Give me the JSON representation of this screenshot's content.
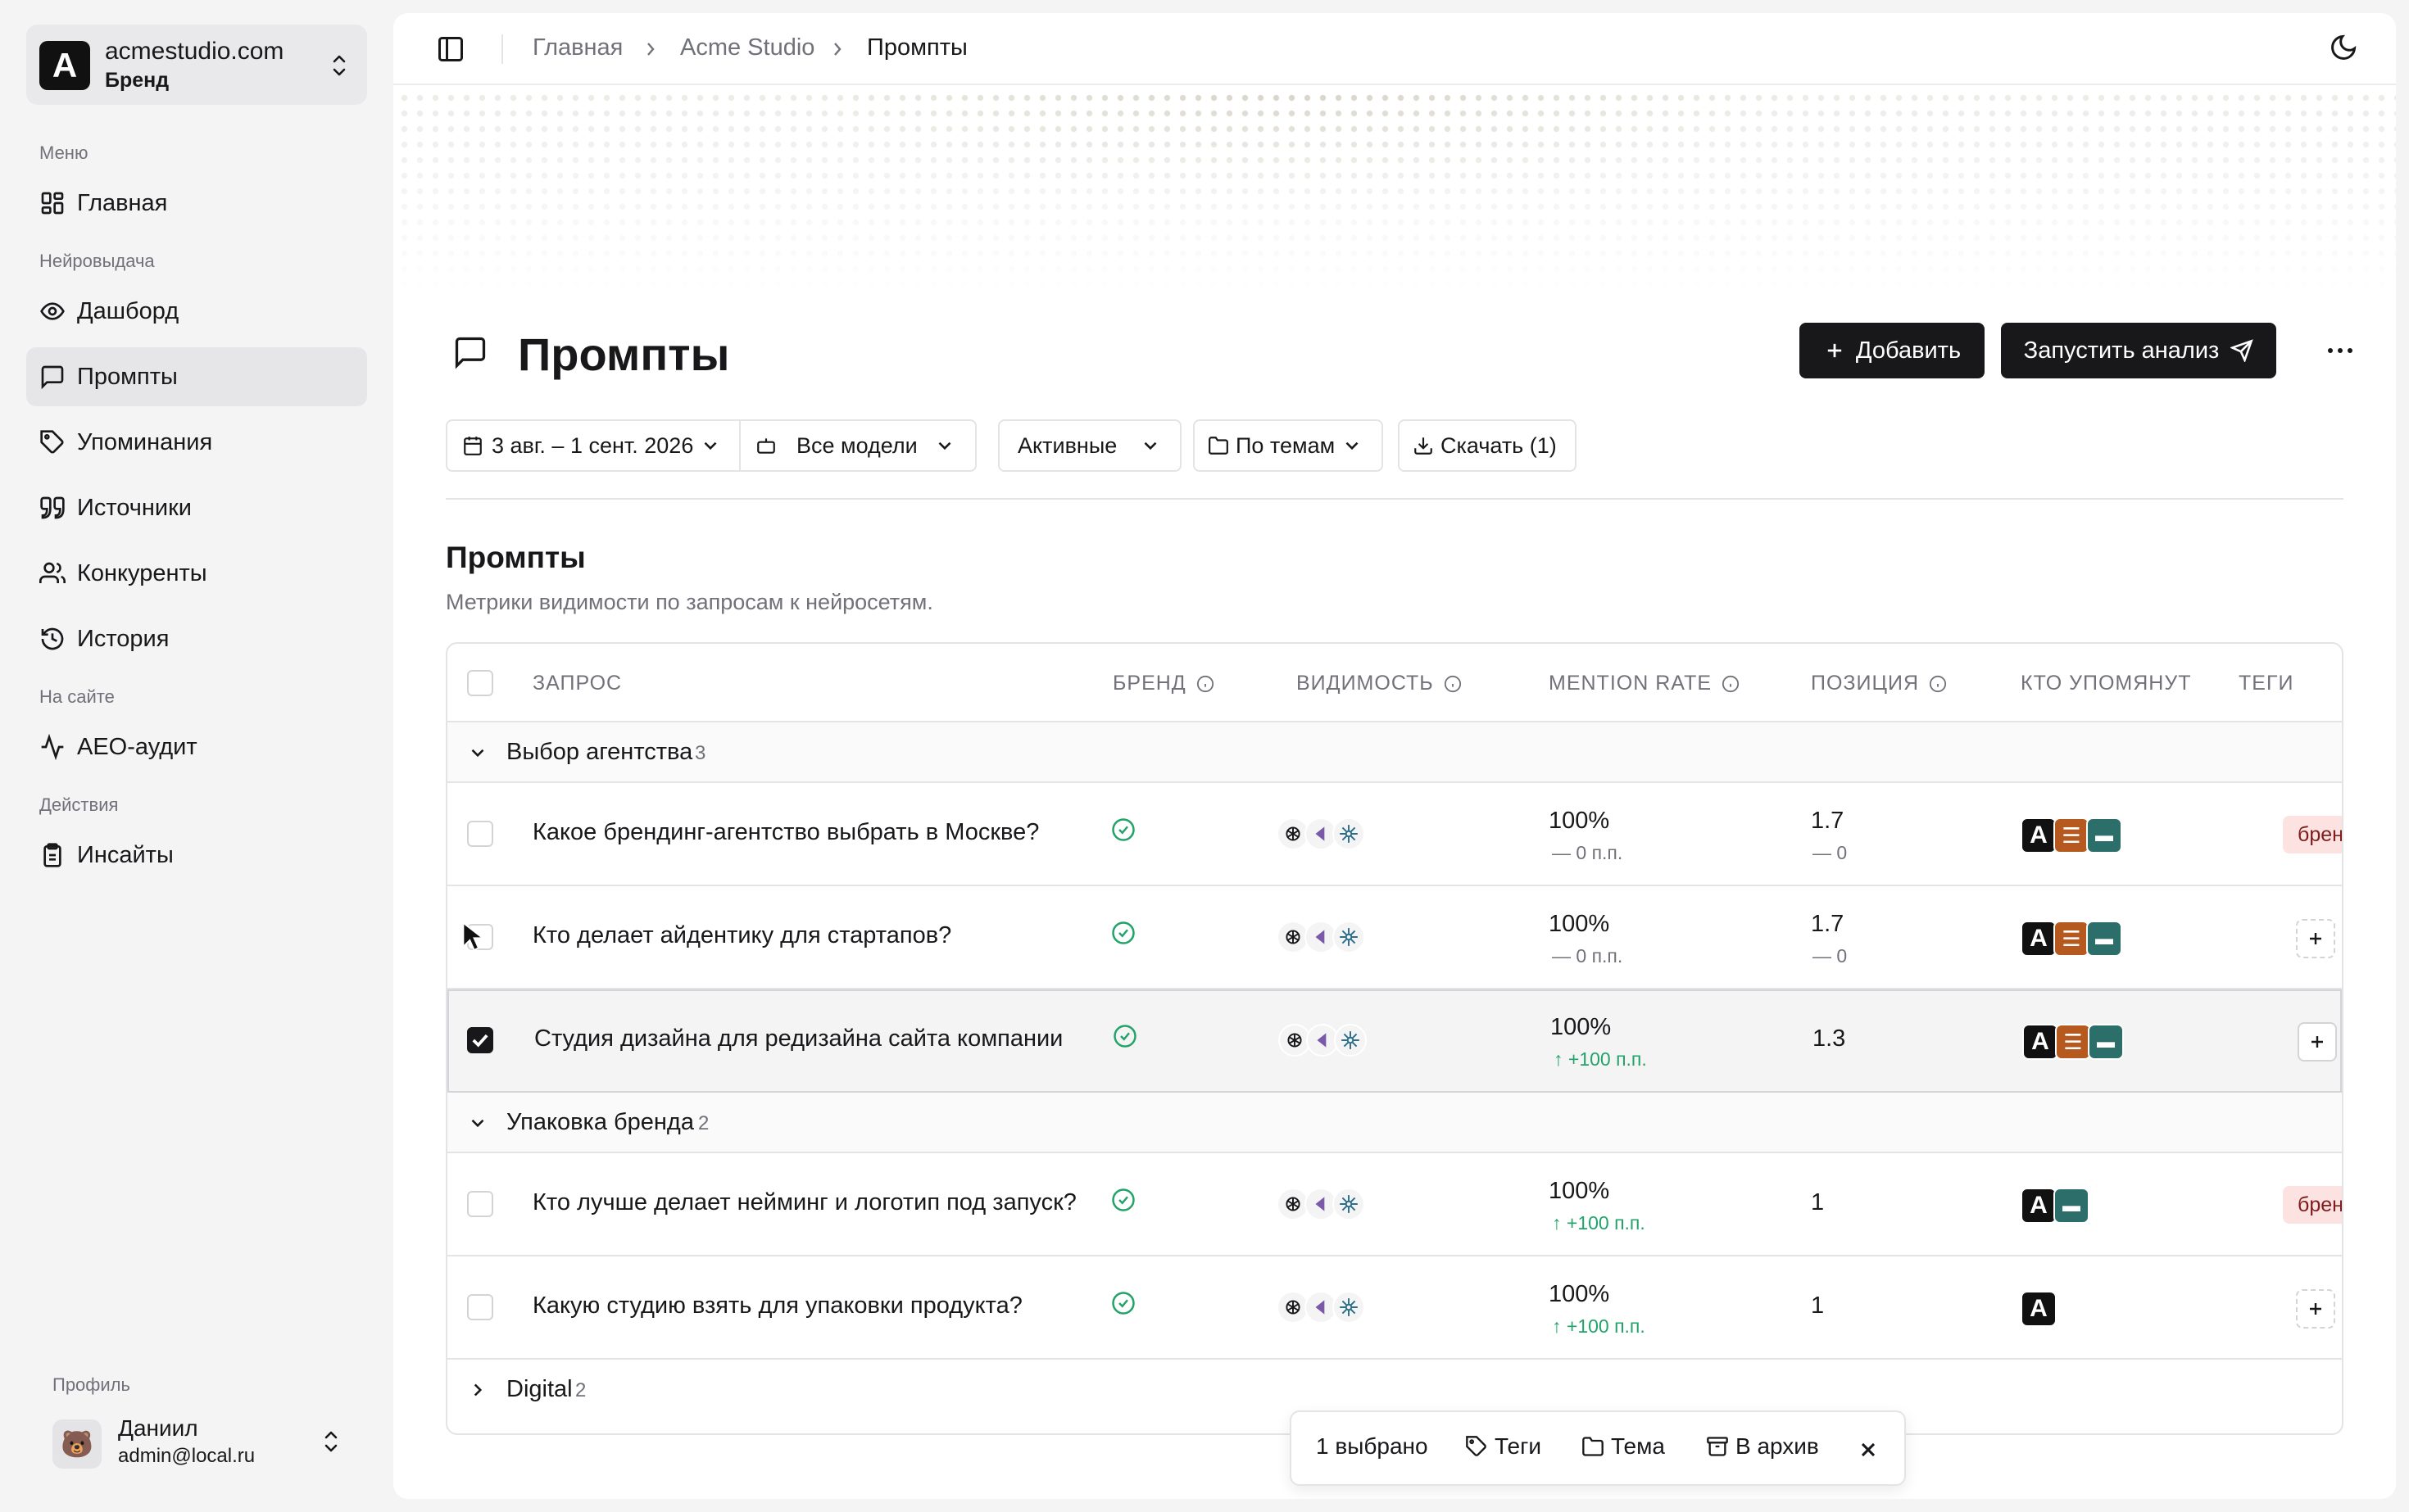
{
  "workspace": {
    "name": "acmestudio.com",
    "subtitle": "Бренд",
    "logo_letter": "A"
  },
  "sidebar": {
    "sections": [
      {
        "label": "Меню",
        "items": [
          {
            "label": "Главная",
            "icon": "grid-icon"
          }
        ]
      },
      {
        "label": "Нейровыдача",
        "items": [
          {
            "label": "Дашборд",
            "icon": "eye-icon"
          },
          {
            "label": "Промпты",
            "icon": "message-square-icon",
            "active": true
          },
          {
            "label": "Упоминания",
            "icon": "tag-icon"
          },
          {
            "label": "Источники",
            "icon": "quote-icon"
          },
          {
            "label": "Конкуренты",
            "icon": "users-icon"
          },
          {
            "label": "История",
            "icon": "history-icon"
          }
        ]
      },
      {
        "label": "На сайте",
        "items": [
          {
            "label": "AEO-аудит",
            "icon": "activity-icon"
          }
        ]
      },
      {
        "label": "Действия",
        "items": [
          {
            "label": "Инсайты",
            "icon": "clipboard-icon"
          }
        ]
      }
    ]
  },
  "profile": {
    "label": "Профиль",
    "name": "Даниил",
    "email": "admin@local.ru",
    "avatar": "🐻"
  },
  "breadcrumb": [
    "Главная",
    "Acme Studio",
    "Промпты"
  ],
  "page": {
    "title": "Промпты",
    "add_button": "Добавить",
    "run_button": "Запустить анализ"
  },
  "filters": {
    "date_range": "3 авг. – 1 сент. 2026",
    "models": "Все модели",
    "status": "Активные",
    "grouping": "По темам",
    "download": "Скачать (1)"
  },
  "section": {
    "title": "Промпты",
    "description": "Метрики видимости по запросам к нейросетям."
  },
  "table": {
    "columns": [
      "ЗАПРОС",
      "БРЕНД",
      "ВИДИМОСТЬ",
      "MENTION RATE",
      "ПОЗИЦИЯ",
      "КТО УПОМЯНУТ",
      "ТЕГИ"
    ],
    "groups": [
      {
        "name": "Выбор агентства",
        "count": "3",
        "expanded": true,
        "rows": [
          {
            "query": "Какое брендинг-агентство выбрать в Москве?",
            "rate": "100%",
            "rate_delta": "— 0 п.п.",
            "position": "1.7",
            "position_delta": "— 0",
            "tag": "бренд",
            "selected": false
          },
          {
            "query": "Кто делает айдентику для стартапов?",
            "rate": "100%",
            "rate_delta": "— 0 п.п.",
            "position": "1.7",
            "position_delta": "— 0",
            "tag": "",
            "selected": false
          },
          {
            "query": "Студия дизайна для редизайна сайта компании",
            "rate": "100%",
            "rate_delta": "↑ +100 п.п.",
            "position": "1.3",
            "position_delta": "",
            "tag": "",
            "selected": true
          }
        ]
      },
      {
        "name": "Упаковка бренда",
        "count": "2",
        "expanded": true,
        "rows": [
          {
            "query": "Кто лучше делает нейминг и логотип под запуск?",
            "rate": "100%",
            "rate_delta": "↑ +100 п.п.",
            "position": "1",
            "position_delta": "",
            "tag": "бренд",
            "selected": false
          },
          {
            "query": "Какую студию взять для упаковки продукта?",
            "rate": "100%",
            "rate_delta": "↑ +100 п.п.",
            "position": "1",
            "position_delta": "",
            "tag": "",
            "selected": false
          }
        ]
      },
      {
        "name": "Digital",
        "count": "2",
        "expanded": false,
        "rows": []
      }
    ]
  },
  "mentioned_letter": "A",
  "colors": {
    "accent_dark": "#18181b",
    "positive": "#22a36a",
    "tag_bg": "#fde2e2",
    "brand_orange": "#b6591f",
    "brand_teal": "#2c6e6a"
  },
  "action_bar": {
    "selected": "1 выбрано",
    "tags": "Теги",
    "topic": "Тема",
    "archive": "В архив"
  }
}
